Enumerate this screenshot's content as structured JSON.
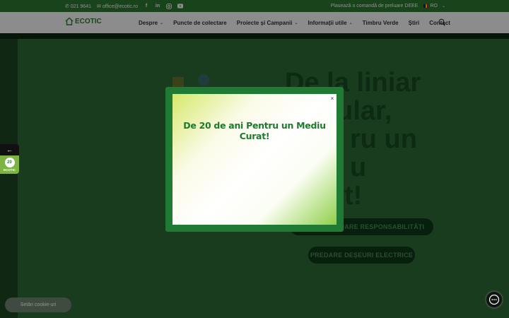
{
  "topbar": {
    "phone": "021 9641",
    "email": "office@ecotic.ro",
    "social_icons": [
      "facebook-icon",
      "linkedin-icon",
      "instagram-icon",
      "youtube-icon"
    ],
    "order_link": "Plasează o comandă de preluare DEEE",
    "language": "RO"
  },
  "nav": {
    "logo_text": "ECOTIC",
    "items": [
      {
        "label": "Despre",
        "dropdown": true
      },
      {
        "label": "Puncte de colectare",
        "dropdown": false
      },
      {
        "label": "Proiecte și Campanii",
        "dropdown": true
      },
      {
        "label": "Informații utile",
        "dropdown": true
      },
      {
        "label": "Timbru Verde",
        "dropdown": false
      },
      {
        "label": "Știri",
        "dropdown": false
      },
      {
        "label": "Contact",
        "dropdown": false
      }
    ]
  },
  "hero": {
    "title_fragments": [
      "De la liniar",
      "cular,",
      "ru un",
      "u",
      "t!"
    ],
    "cta_primary": "LUARE RESPONSABILITĂȚI",
    "cta_secondary": "PREDARE DEȘEURI ELECTRICE"
  },
  "side_tab": {
    "arrow": "←",
    "badge_number": "20",
    "badge_label": "ECOTIC"
  },
  "cookie_button": "Setări cookie-uri",
  "modal": {
    "title": "De 20 de ani Pentru un Mediu Curat!",
    "close": "×"
  },
  "colors": {
    "brand_green": "#2e7d32",
    "modal_frame": "#1f7a33",
    "title_green": "#1e7a2e"
  }
}
